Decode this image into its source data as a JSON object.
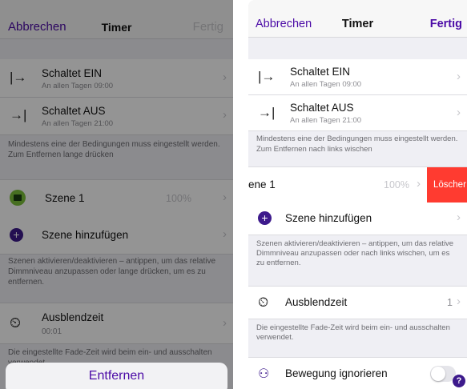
{
  "left": {
    "header": {
      "cancel": "Abbrechen",
      "title": "Timer",
      "done": "Fertig"
    },
    "rows": {
      "on": {
        "title": "Schaltet EIN",
        "subtitle": "An allen Tagen 09:00"
      },
      "off": {
        "title": "Schaltet AUS",
        "subtitle": "An allen Tagen 21:00"
      }
    },
    "conditions_note": "Mindestens eine der Bedingungen muss eingestellt werden. Zum Entfernen lange drücken",
    "scene": {
      "label": "Szene 1",
      "value": "100%"
    },
    "add_scene": "Szene hinzufügen",
    "scenes_note": "Szenen aktivieren/deaktivieren – antippen, um das relative Dimmniveau anzupassen oder lange drücken, um es zu entfernen.",
    "fade": {
      "title": "Ausblendzeit",
      "subtitle": "00:01"
    },
    "fade_note": "Die eingestellte Fade-Zeit wird beim ein- und ausschalten verwendet.",
    "action_sheet": {
      "remove": "Entfernen"
    }
  },
  "right": {
    "header": {
      "cancel": "Abbrechen",
      "title": "Timer",
      "done": "Fertig"
    },
    "rows": {
      "on": {
        "title": "Schaltet EIN",
        "subtitle": "An allen Tagen  09:00"
      },
      "off": {
        "title": "Schaltet AUS",
        "subtitle": "An allen Tagen  21:00"
      }
    },
    "conditions_note": "Mindestens eine der Bedingungen muss eingestellt werden. Zum Entfernen nach links wischen",
    "scene": {
      "label": "ene 1",
      "value": "100%",
      "delete": "Löscher"
    },
    "add_scene": "Szene hinzufügen",
    "scenes_note": "Szenen aktivieren/deaktivieren – antippen, um das relative Dimmniveau anzupassen oder nach links wischen, um es zu entfernen.",
    "fade": {
      "title": "Ausblendzeit",
      "value": "1"
    },
    "fade_note": "Die eingestellte Fade-Zeit wird beim ein- und ausschalten verwendet.",
    "motion": {
      "label": "Bewegung ignorieren",
      "help": "?"
    }
  },
  "colors": {
    "accent": "#4b0aa6",
    "icon_purple": "#3d1a8c",
    "delete_red": "#ff3b30",
    "scene_icon_green": "#2e7d32"
  }
}
